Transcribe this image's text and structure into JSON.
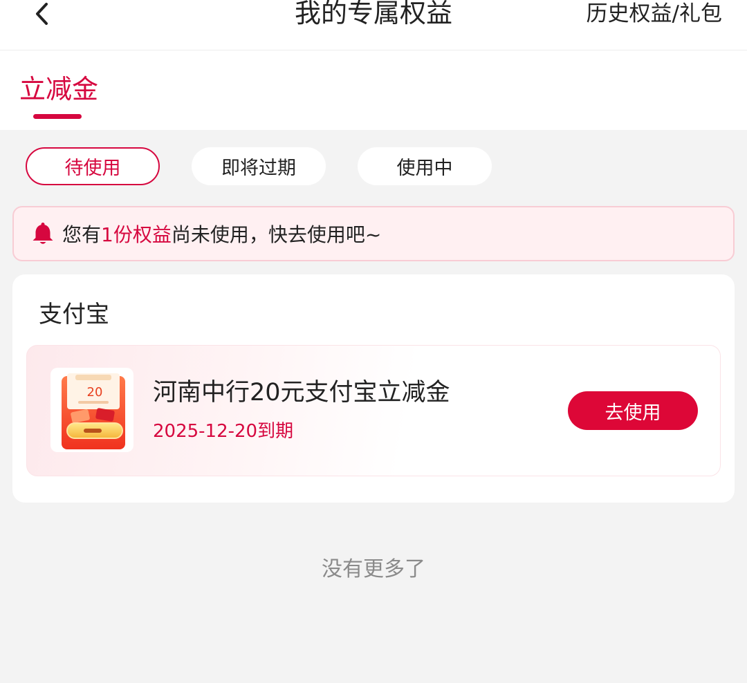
{
  "header": {
    "title": "我的专属权益",
    "history_link": "历史权益/礼包",
    "back_icon": "chevron-left-icon"
  },
  "tabs": [
    {
      "label": "立减金",
      "active": true
    }
  ],
  "filters": [
    {
      "label": "待使用",
      "active": true
    },
    {
      "label": "即将过期",
      "active": false
    },
    {
      "label": "使用中",
      "active": false
    }
  ],
  "notice": {
    "icon": "bell-icon",
    "prefix": "您有",
    "highlight": "1份权益",
    "suffix": "尚未使用，快去使用吧~"
  },
  "group": {
    "title": "支付宝",
    "coupon": {
      "thumb_amount": "20",
      "name": "河南中行20元支付宝立减金",
      "expiry": "2025-12-20到期",
      "button": "去使用"
    }
  },
  "footer": {
    "no_more": "没有更多了"
  },
  "colors": {
    "accent": "#d6073f",
    "button": "#dd0737",
    "notice_bg": "#fff0f2",
    "page_bg": "#f3f3f3"
  }
}
